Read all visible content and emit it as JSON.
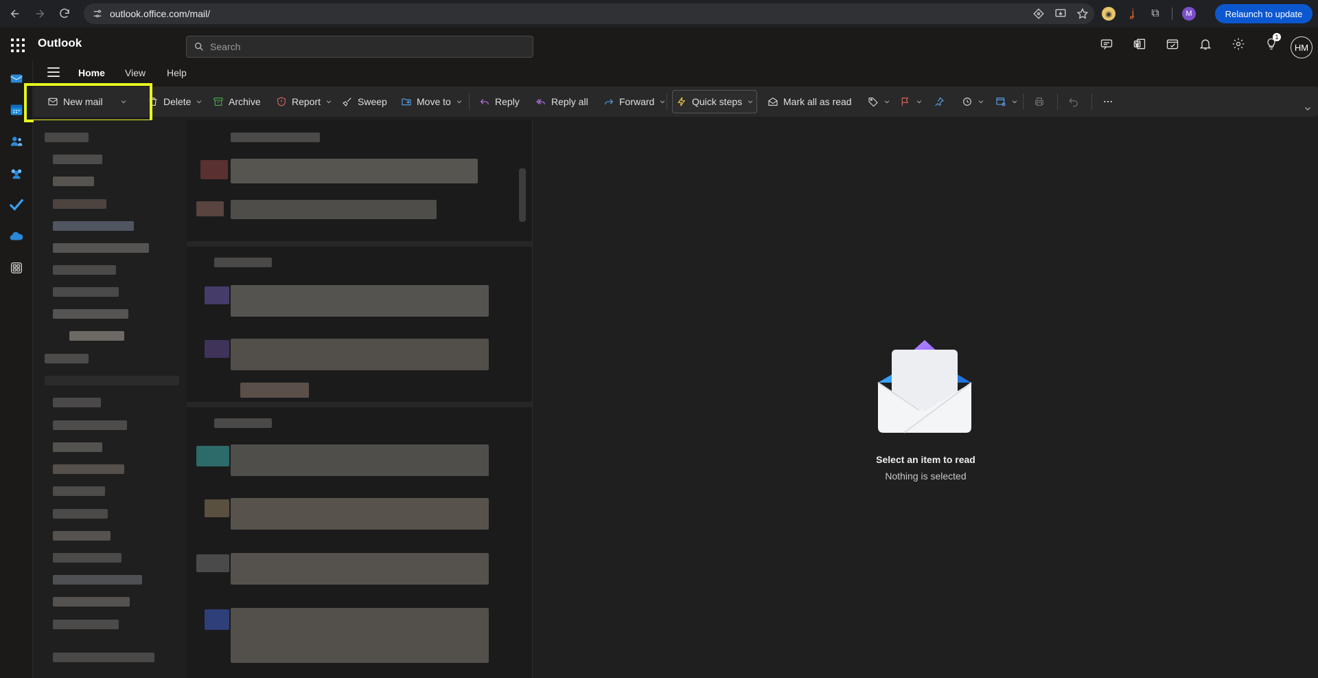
{
  "browser": {
    "url": "outlook.office.com/mail/",
    "relaunch_label": "Relaunch to update",
    "profile_initial": "M"
  },
  "header": {
    "app_name": "Outlook",
    "search_placeholder": "Search",
    "notification_count": "1",
    "avatar_initials": "HM"
  },
  "tabs": [
    {
      "label": "Home"
    },
    {
      "label": "View"
    },
    {
      "label": "Help"
    }
  ],
  "ribbon": {
    "new_mail": "New mail",
    "delete": "Delete",
    "archive": "Archive",
    "report": "Report",
    "sweep": "Sweep",
    "move_to": "Move to",
    "reply": "Reply",
    "reply_all": "Reply all",
    "forward": "Forward",
    "quick_steps": "Quick steps",
    "mark_all_read": "Mark all as read"
  },
  "reading_pane": {
    "title": "Select an item to read",
    "subtitle": "Nothing is selected"
  },
  "colors": {
    "highlight": "#e6f51f",
    "accent": "#0b57d0"
  }
}
